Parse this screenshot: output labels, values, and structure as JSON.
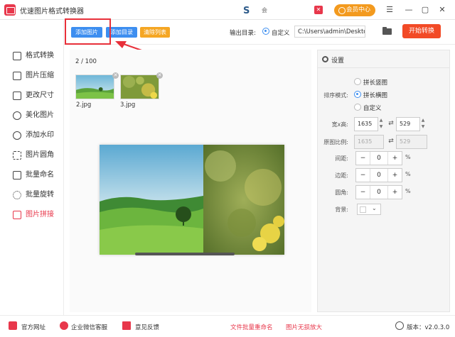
{
  "app": {
    "title": "优速图片格式转换器"
  },
  "titlebar": {
    "vip_label": "会员中心",
    "badge_text": "会",
    "logo_text": "S",
    "badge_glyph": "✕"
  },
  "toolbar": {
    "add_image": "添加图片",
    "add_folder": "添加目录",
    "clear_list": "清除列表",
    "output_dir_label": "输出目录:",
    "custom_label": "自定义",
    "output_path": "C:\\Users\\admin\\Deskto",
    "start_label": "开始转换"
  },
  "sidebar": {
    "items": [
      {
        "label": "格式转换",
        "active": false
      },
      {
        "label": "图片压缩",
        "active": false
      },
      {
        "label": "更改尺寸",
        "active": false
      },
      {
        "label": "美化图片",
        "active": false
      },
      {
        "label": "添加水印",
        "active": false
      },
      {
        "label": "图片圆角",
        "active": false
      },
      {
        "label": "批量命名",
        "active": false
      },
      {
        "label": "批量旋转",
        "active": false
      },
      {
        "label": "图片拼接",
        "active": true
      }
    ]
  },
  "main": {
    "count": "2 / 100",
    "files": [
      {
        "name": "2.jpg"
      },
      {
        "name": "3.jpg"
      }
    ]
  },
  "settings": {
    "title": "设置",
    "mode_label": "排序模式:",
    "modes": [
      {
        "label": "拼长竖图",
        "selected": false
      },
      {
        "label": "拼长横图",
        "selected": true
      },
      {
        "label": "自定义",
        "selected": false
      }
    ],
    "size_label": "宽x高:",
    "width": "1635",
    "height": "529",
    "ratio_label": "原图比例:",
    "ratio_w": "1635",
    "ratio_h": "529",
    "spacing_label": "间距:",
    "spacing": "0",
    "margin_label": "边距:",
    "margin": "0",
    "radius_label": "圆角:",
    "radius": "0",
    "bg_label": "背景:",
    "percent": "%",
    "minus": "−",
    "plus": "+"
  },
  "footer": {
    "website": "官方网址",
    "wechat": "企业微信客服",
    "feedback": "意见反馈",
    "batch_rename": "文件批量重命名",
    "enlarge": "图片无损放大",
    "version": "版本：v2.0.3.0"
  },
  "colors": {
    "accent": "#3d8ef0",
    "active": "#e8374b",
    "start": "#f24a26",
    "orange": "#f5a623"
  }
}
